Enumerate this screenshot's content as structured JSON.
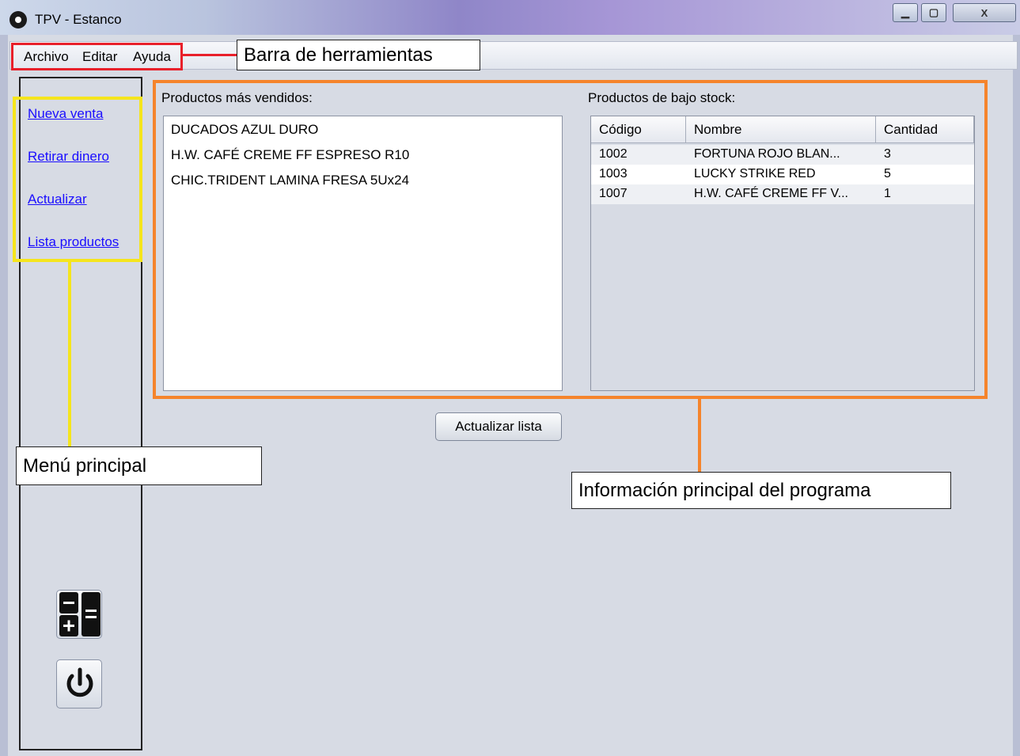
{
  "window": {
    "title": "TPV - Estanco",
    "minimize_glyph": "▁",
    "maximize_glyph": "▢",
    "close_glyph": "X"
  },
  "menubar": {
    "items": [
      "Archivo",
      "Editar",
      "Ayuda"
    ]
  },
  "sidebar": {
    "links": [
      "Nueva venta",
      "Retirar dinero",
      "Actualizar",
      "Lista productos"
    ],
    "icons": [
      "calculator-icon",
      "power-icon"
    ]
  },
  "main": {
    "top_products_label": "Productos más vendidos:",
    "top_products": [
      "DUCADOS AZUL DURO",
      "H.W. CAFÉ CREME FF ESPRESO R10",
      "CHIC.TRIDENT LAMINA FRESA 5Ux24"
    ],
    "low_stock_label": "Productos de bajo stock:",
    "low_stock_table": {
      "headers": [
        "Código",
        "Nombre",
        "Cantidad"
      ],
      "rows": [
        [
          "1002",
          "FORTUNA ROJO BLAN...",
          "3"
        ],
        [
          "1003",
          "LUCKY STRIKE RED",
          "5"
        ],
        [
          "1007",
          "H.W. CAFÉ CREME FF V...",
          "1"
        ]
      ]
    },
    "refresh_button": "Actualizar lista"
  },
  "annotations": {
    "toolbar_callout": "Barra de herramientas",
    "menu_callout": "Menú principal",
    "info_callout": "Información principal del programa",
    "colors": {
      "toolbar": "#e8202a",
      "menu": "#f5e51d",
      "info": "#f5842c"
    }
  }
}
